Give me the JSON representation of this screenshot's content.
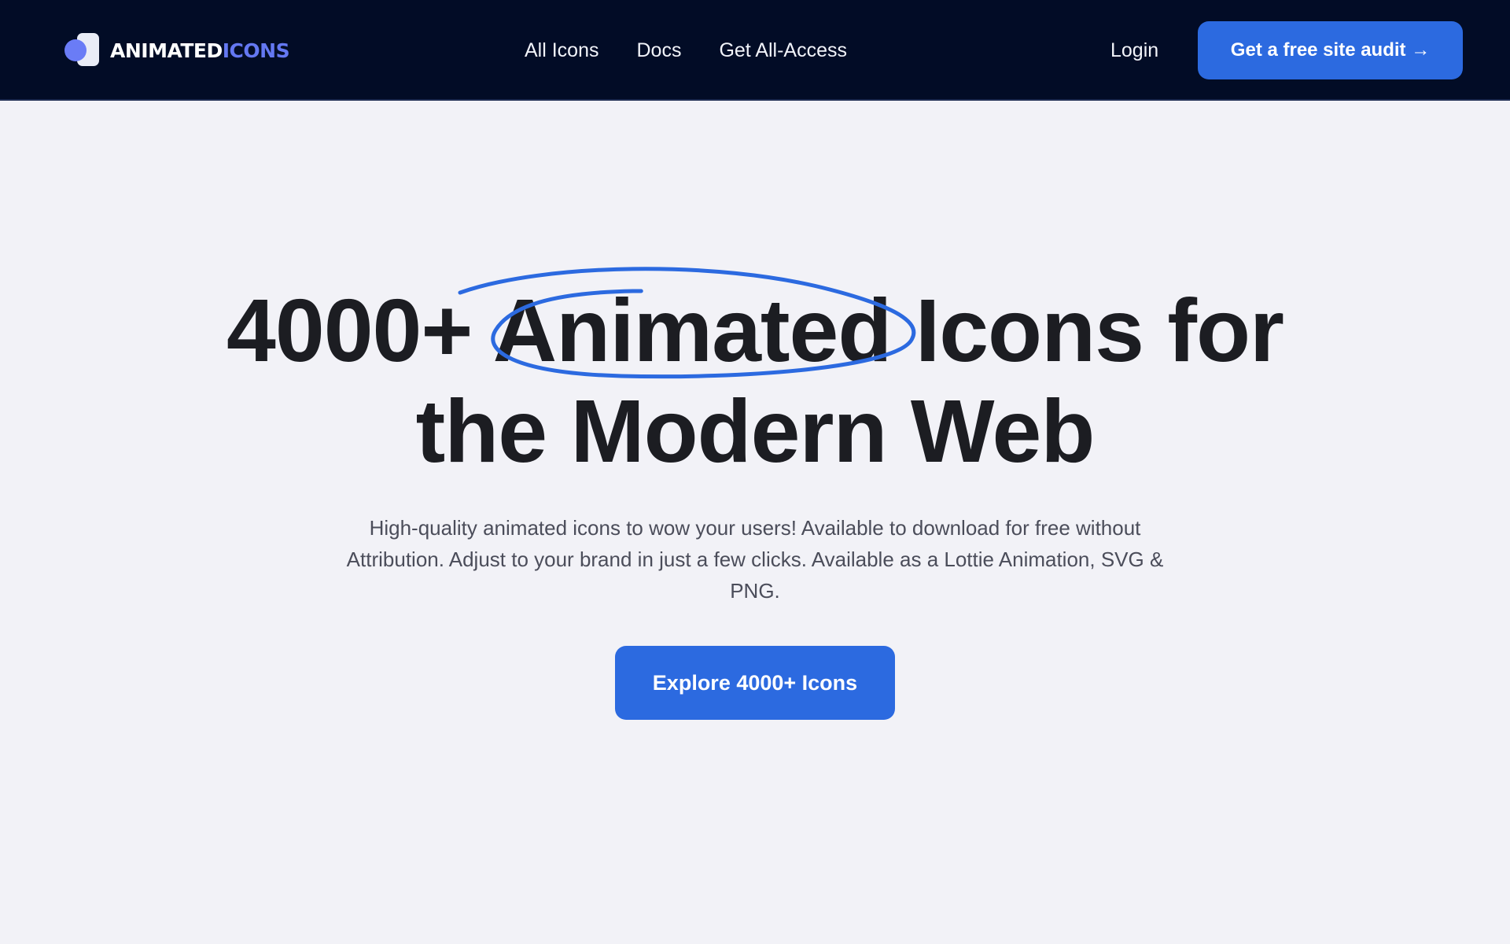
{
  "header": {
    "logo": {
      "icon": "animatedicons-logo-icon",
      "text_part1": "ANIMATED",
      "text_part2": "ICONS",
      "colors": {
        "part1": "#ffffff",
        "part2": "#6478f2"
      }
    },
    "nav": [
      {
        "label": "All Icons"
      },
      {
        "label": "Docs"
      },
      {
        "label": "Get All-Access"
      }
    ],
    "login_label": "Login",
    "cta_label": "Get a free site audit →"
  },
  "hero": {
    "title_line1": "4000+ Animated Icons for",
    "title_line2": "the Modern Web",
    "highlight_word": "Animated",
    "subtitle": "High-quality animated icons to wow your users! Available to download for free without Attribution. Adjust to your brand in just a few clicks. Available as a Lottie Animation, SVG & PNG.",
    "cta_label": "Explore 4000+ Icons"
  },
  "colors": {
    "header_bg": "#020c26",
    "page_bg": "#f2f2f7",
    "accent": "#2c6ae0",
    "title_text": "#1c1d22",
    "body_text": "#4b4d5a"
  }
}
